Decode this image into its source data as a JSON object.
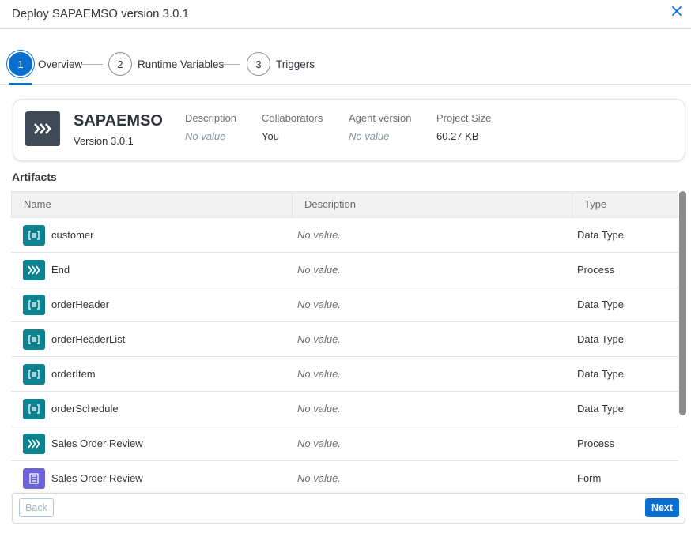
{
  "dialog": {
    "title": "Deploy SAPAEMSO version 3.0.1",
    "close_icon": "close-icon"
  },
  "wizard": {
    "steps": [
      {
        "number": "1",
        "label": "Overview",
        "active": true
      },
      {
        "number": "2",
        "label": "Runtime Variables",
        "active": false
      },
      {
        "number": "3",
        "label": "Triggers",
        "active": false
      }
    ]
  },
  "project": {
    "icon": "process-chevrons-icon",
    "name": "SAPAEMSO",
    "version": "Version 3.0.1",
    "meta": [
      {
        "key": "Description",
        "value": "No value",
        "is_empty": true
      },
      {
        "key": "Collaborators",
        "value": "You",
        "is_empty": false
      },
      {
        "key": "Agent version",
        "value": "No value",
        "is_empty": true
      },
      {
        "key": "Project Size",
        "value": "60.27 KB",
        "is_empty": false
      }
    ]
  },
  "artifacts": {
    "title": "Artifacts",
    "columns": [
      "Name",
      "Description",
      "Type"
    ],
    "rows": [
      {
        "icon": "data-type-icon",
        "name": "customer",
        "description": "No value.",
        "type": "Data Type"
      },
      {
        "icon": "process-icon",
        "name": "End",
        "description": "No value.",
        "type": "Process"
      },
      {
        "icon": "data-type-icon",
        "name": "orderHeader",
        "description": "No value.",
        "type": "Data Type"
      },
      {
        "icon": "data-type-icon",
        "name": "orderHeaderList",
        "description": "No value.",
        "type": "Data Type"
      },
      {
        "icon": "data-type-icon",
        "name": "orderItem",
        "description": "No value.",
        "type": "Data Type"
      },
      {
        "icon": "data-type-icon",
        "name": "orderSchedule",
        "description": "No value.",
        "type": "Data Type"
      },
      {
        "icon": "process-icon",
        "name": "Sales Order Review",
        "description": "No value.",
        "type": "Process"
      },
      {
        "icon": "form-icon",
        "name": "Sales Order Review",
        "description": "No value.",
        "type": "Form"
      }
    ]
  },
  "footer": {
    "back_label": "Back",
    "next_label": "Next"
  },
  "colors": {
    "accent": "#0a6ed1",
    "teal": "#0f828f",
    "form": "#6c63d8",
    "project_icon_bg": "#3f4a56"
  }
}
